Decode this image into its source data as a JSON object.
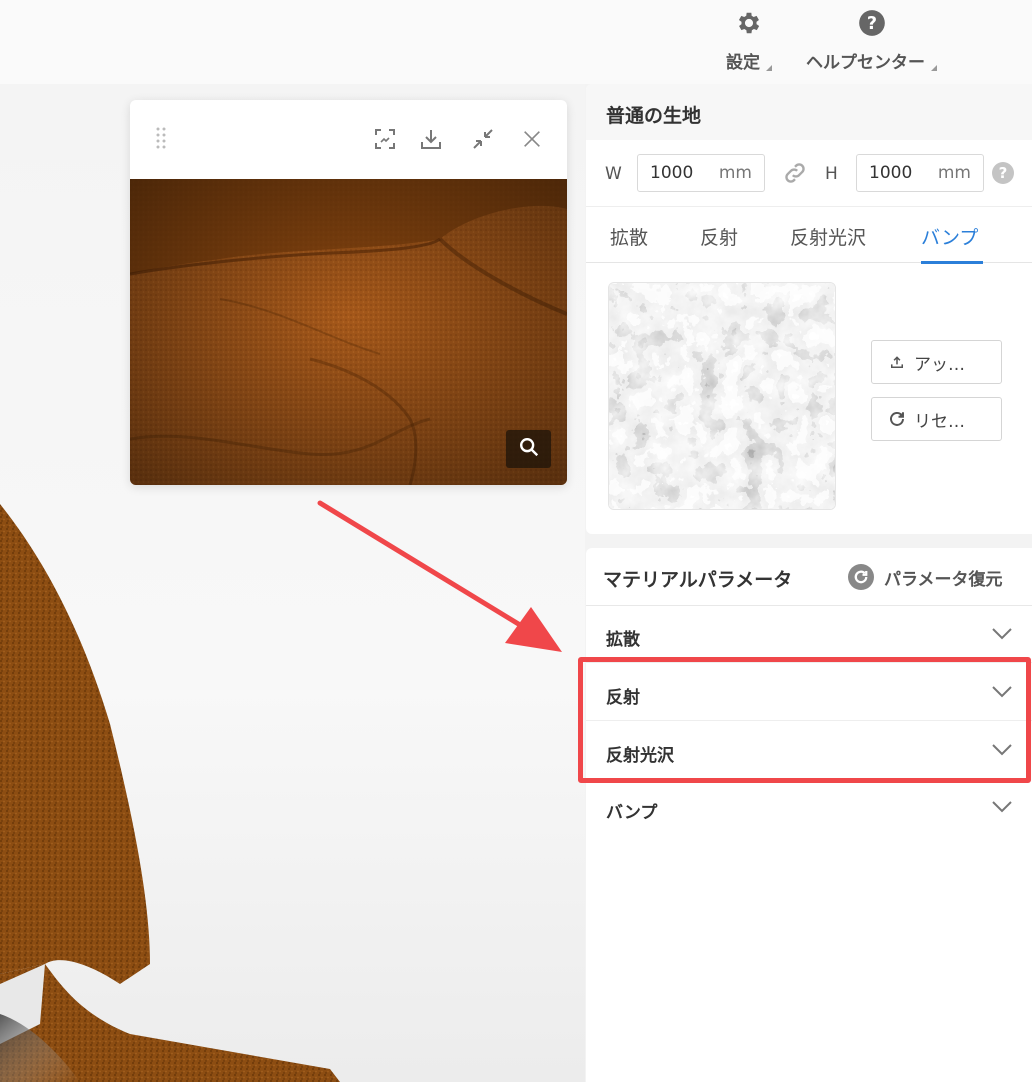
{
  "topbar": {
    "settings_label": "設定",
    "help_label": "ヘルプセンター"
  },
  "preview": {
    "icons": [
      "screenshot-icon",
      "download-icon",
      "collapse-icon",
      "close-icon"
    ],
    "zoom_icon": "search-icon"
  },
  "material": {
    "name": "普通の生地",
    "width_label": "W",
    "width_value": "1000",
    "width_unit": "mm",
    "height_label": "H",
    "height_value": "1000",
    "height_unit": "mm",
    "help_symbol": "?",
    "tabs": [
      {
        "label": "拡散",
        "active": false
      },
      {
        "label": "反射",
        "active": false
      },
      {
        "label": "反射光沢",
        "active": false
      },
      {
        "label": "バンプ",
        "active": true
      }
    ],
    "upload_label": "アッ…",
    "reset_label": "リセ…"
  },
  "params": {
    "title": "マテリアルパラメータ",
    "restore_label": "パラメータ復元",
    "sections": [
      "拡散",
      "反射",
      "反射光沢",
      "バンプ"
    ]
  },
  "colors": {
    "accent": "#2b7fd9",
    "highlight": "#f0474a",
    "fabric": "#8a4a0f"
  }
}
